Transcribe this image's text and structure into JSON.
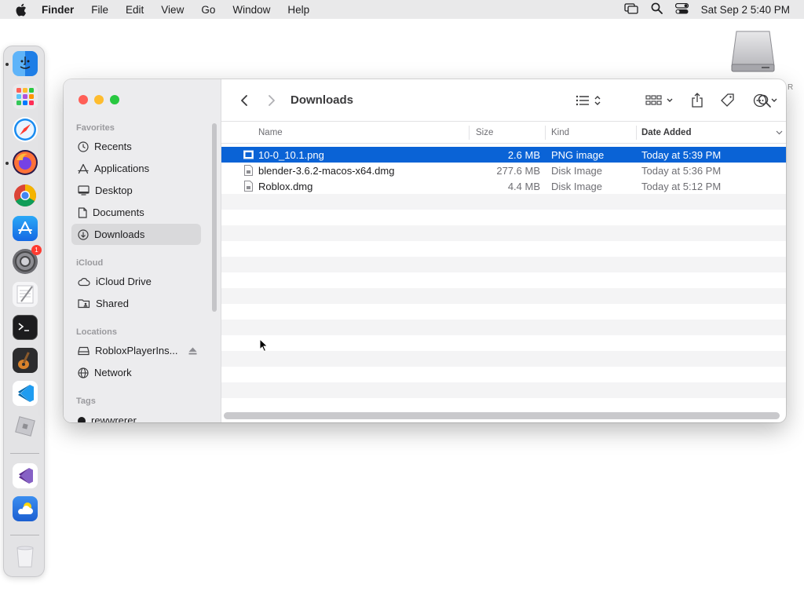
{
  "menubar": {
    "app": "Finder",
    "items": [
      "File",
      "Edit",
      "View",
      "Go",
      "Window",
      "Help"
    ],
    "clock": "Sat Sep 2  5:40 PM"
  },
  "desktop": {
    "drive_label": "R"
  },
  "dock": {
    "apps": [
      "Finder",
      "Launchpad",
      "Safari",
      "Firefox",
      "Chrome",
      "App Store",
      "System Settings",
      "TextEdit",
      "Terminal",
      "GarageBand",
      "Visual Studio Code",
      "Roblox",
      "Visual Studio",
      "Weather",
      "Trash"
    ],
    "settings_badge": "1"
  },
  "finder": {
    "title": "Downloads",
    "sidebar": {
      "favorites_header": "Favorites",
      "favorites": [
        "Recents",
        "Applications",
        "Desktop",
        "Documents",
        "Downloads"
      ],
      "icloud_header": "iCloud",
      "icloud": [
        "iCloud Drive",
        "Shared"
      ],
      "locations_header": "Locations",
      "locations": [
        "RobloxPlayerIns...",
        "Network"
      ],
      "tags_header": "Tags",
      "tags": [
        "rewwrerer"
      ]
    },
    "columns": {
      "name": "Name",
      "size": "Size",
      "kind": "Kind",
      "date": "Date Added"
    },
    "files": [
      {
        "name": "10-0_10.1.png",
        "size": "2.6 MB",
        "kind": "PNG image",
        "date": "Today at 5:39 PM"
      },
      {
        "name": "blender-3.6.2-macos-x64.dmg",
        "size": "277.6 MB",
        "kind": "Disk Image",
        "date": "Today at 5:36 PM"
      },
      {
        "name": "Roblox.dmg",
        "size": "4.4 MB",
        "kind": "Disk Image",
        "date": "Today at 5:12 PM"
      }
    ],
    "selected_file": "10-0_10.1.png"
  },
  "colors": {
    "selection": "#0a63d6",
    "close": "#ff5f57",
    "minimize": "#febc2e",
    "zoom": "#28c840"
  }
}
